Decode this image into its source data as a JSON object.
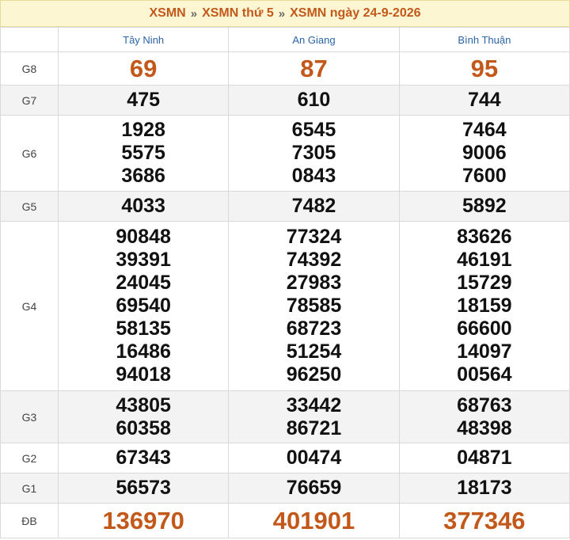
{
  "breadcrumb": {
    "items": [
      "XSMN",
      "XSMN thứ 5",
      "XSMN ngày 24-9-2026"
    ],
    "separator": "»"
  },
  "columns": [
    "Tây Ninh",
    "An Giang",
    "Bình Thuận"
  ],
  "rows": [
    {
      "label": "G8",
      "values": [
        [
          "69"
        ],
        [
          "87"
        ],
        [
          "95"
        ]
      ]
    },
    {
      "label": "G7",
      "values": [
        [
          "475"
        ],
        [
          "610"
        ],
        [
          "744"
        ]
      ]
    },
    {
      "label": "G6",
      "values": [
        [
          "1928",
          "5575",
          "3686"
        ],
        [
          "6545",
          "7305",
          "0843"
        ],
        [
          "7464",
          "9006",
          "7600"
        ]
      ]
    },
    {
      "label": "G5",
      "values": [
        [
          "4033"
        ],
        [
          "7482"
        ],
        [
          "5892"
        ]
      ]
    },
    {
      "label": "G4",
      "values": [
        [
          "90848",
          "39391",
          "24045",
          "69540",
          "58135",
          "16486",
          "94018"
        ],
        [
          "77324",
          "74392",
          "27983",
          "78585",
          "68723",
          "51254",
          "96250"
        ],
        [
          "83626",
          "46191",
          "15729",
          "18159",
          "66600",
          "14097",
          "00564"
        ]
      ]
    },
    {
      "label": "G3",
      "values": [
        [
          "43805",
          "60358"
        ],
        [
          "33442",
          "86721"
        ],
        [
          "68763",
          "48398"
        ]
      ]
    },
    {
      "label": "G2",
      "values": [
        [
          "67343"
        ],
        [
          "00474"
        ],
        [
          "04871"
        ]
      ]
    },
    {
      "label": "G1",
      "values": [
        [
          "56573"
        ],
        [
          "76659"
        ],
        [
          "18173"
        ]
      ]
    },
    {
      "label": "ĐB",
      "values": [
        [
          "136970"
        ],
        [
          "401901"
        ],
        [
          "377346"
        ]
      ]
    }
  ],
  "colors": {
    "accent": "#c2581a",
    "header_bg": "#fdf6d3",
    "column_title": "#2a64a6",
    "alt_row": "#f3f3f3"
  }
}
